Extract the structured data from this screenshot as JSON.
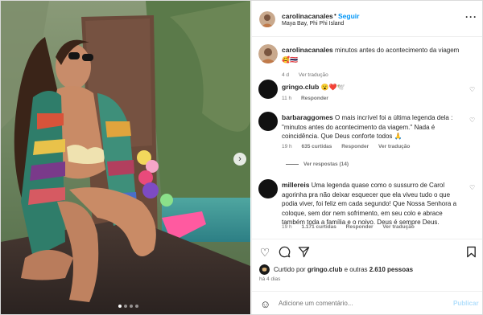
{
  "post": {
    "username": "carolinacanales",
    "follow_label": "Seguir",
    "location": "Maya Bay, Phi Phi Island",
    "caption": {
      "username": "carolinacanales",
      "text": "minutos antes do acontecimento da viagem",
      "emojis": "🥰🇹🇭",
      "time": "4 d",
      "translate": "Ver tradução"
    }
  },
  "comments": [
    {
      "username": "gringo.club",
      "text": "😮❤️🕊️",
      "time": "11 h",
      "reply": "Responder"
    },
    {
      "username": "barbaraggomes",
      "text": "O mais incrível foi a última legenda dela : \"minutos antes do acontecimento da viagem.\" Nada é coincidência. Que Deus conforte todos 🙏",
      "time": "19 h",
      "likes": "635 curtidas",
      "reply": "Responder",
      "translate": "Ver tradução",
      "view_replies": "Ver respostas (14)"
    },
    {
      "username": "millereis",
      "text": "Uma legenda quase como o sussurro de Carol agorinha pra não deixar esquecer que ela viveu tudo o que podia viver, foi feliz em cada segundo! Que Nossa Senhora a coloque, sem dor nem sofrimento, em seu colo e abrace também toda a família e o noivo. Deus é sempre Deus.",
      "time": "19 h",
      "likes": "1.171 curtidas",
      "reply": "Responder",
      "translate": "Ver tradução"
    }
  ],
  "actions": {
    "liked_by_prefix": "Curtido por",
    "liked_by_user": "gringo.club",
    "liked_by_and": "e outras",
    "likes_count": "2.610 pessoas",
    "date": "há 4 dias"
  },
  "add_comment": {
    "placeholder": "Adicione um comentário...",
    "publish_label": "Publicar"
  },
  "colors": {
    "accent": "#0095f6",
    "publish_disabled": "#b2dffc",
    "muted_text": "#737373"
  },
  "icons": {
    "like": "heart-icon",
    "comment": "comment-icon",
    "share": "send-icon",
    "save": "bookmark-icon",
    "more": "more-options-icon",
    "emoji": "emoji-icon",
    "next": "chevron-right-icon"
  }
}
